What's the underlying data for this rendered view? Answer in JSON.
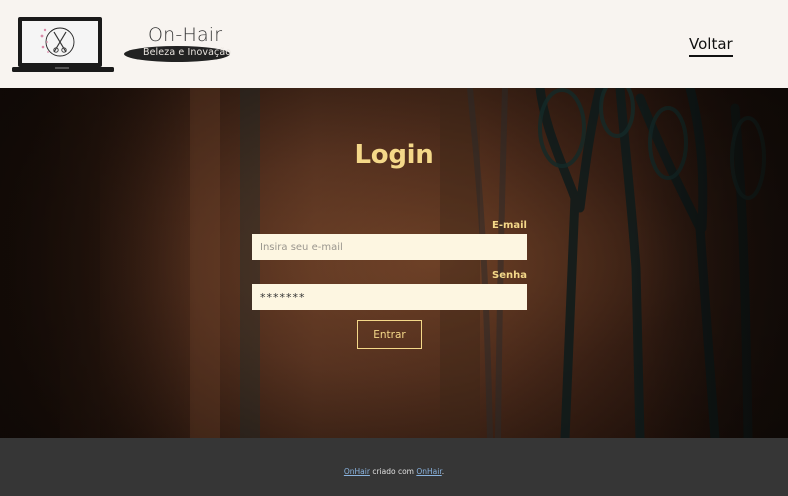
{
  "header": {
    "brand_name": "On-Hair",
    "brand_tagline": "Beleza e Inovação",
    "back_link": "Voltar"
  },
  "login": {
    "title": "Login",
    "email_label": "E-mail",
    "email_placeholder": "Insira seu e-mail",
    "password_label": "Senha",
    "password_value": "*******",
    "submit_label": "Entrar"
  },
  "footer": {
    "link1": "OnHair",
    "middle_text": " criado com ",
    "link2": "OnHair",
    "end_text": "."
  },
  "colors": {
    "accent": "#f4d889",
    "header_bg": "#f8f4f0",
    "footer_bg": "#363636",
    "input_bg": "#fdf6e1"
  }
}
